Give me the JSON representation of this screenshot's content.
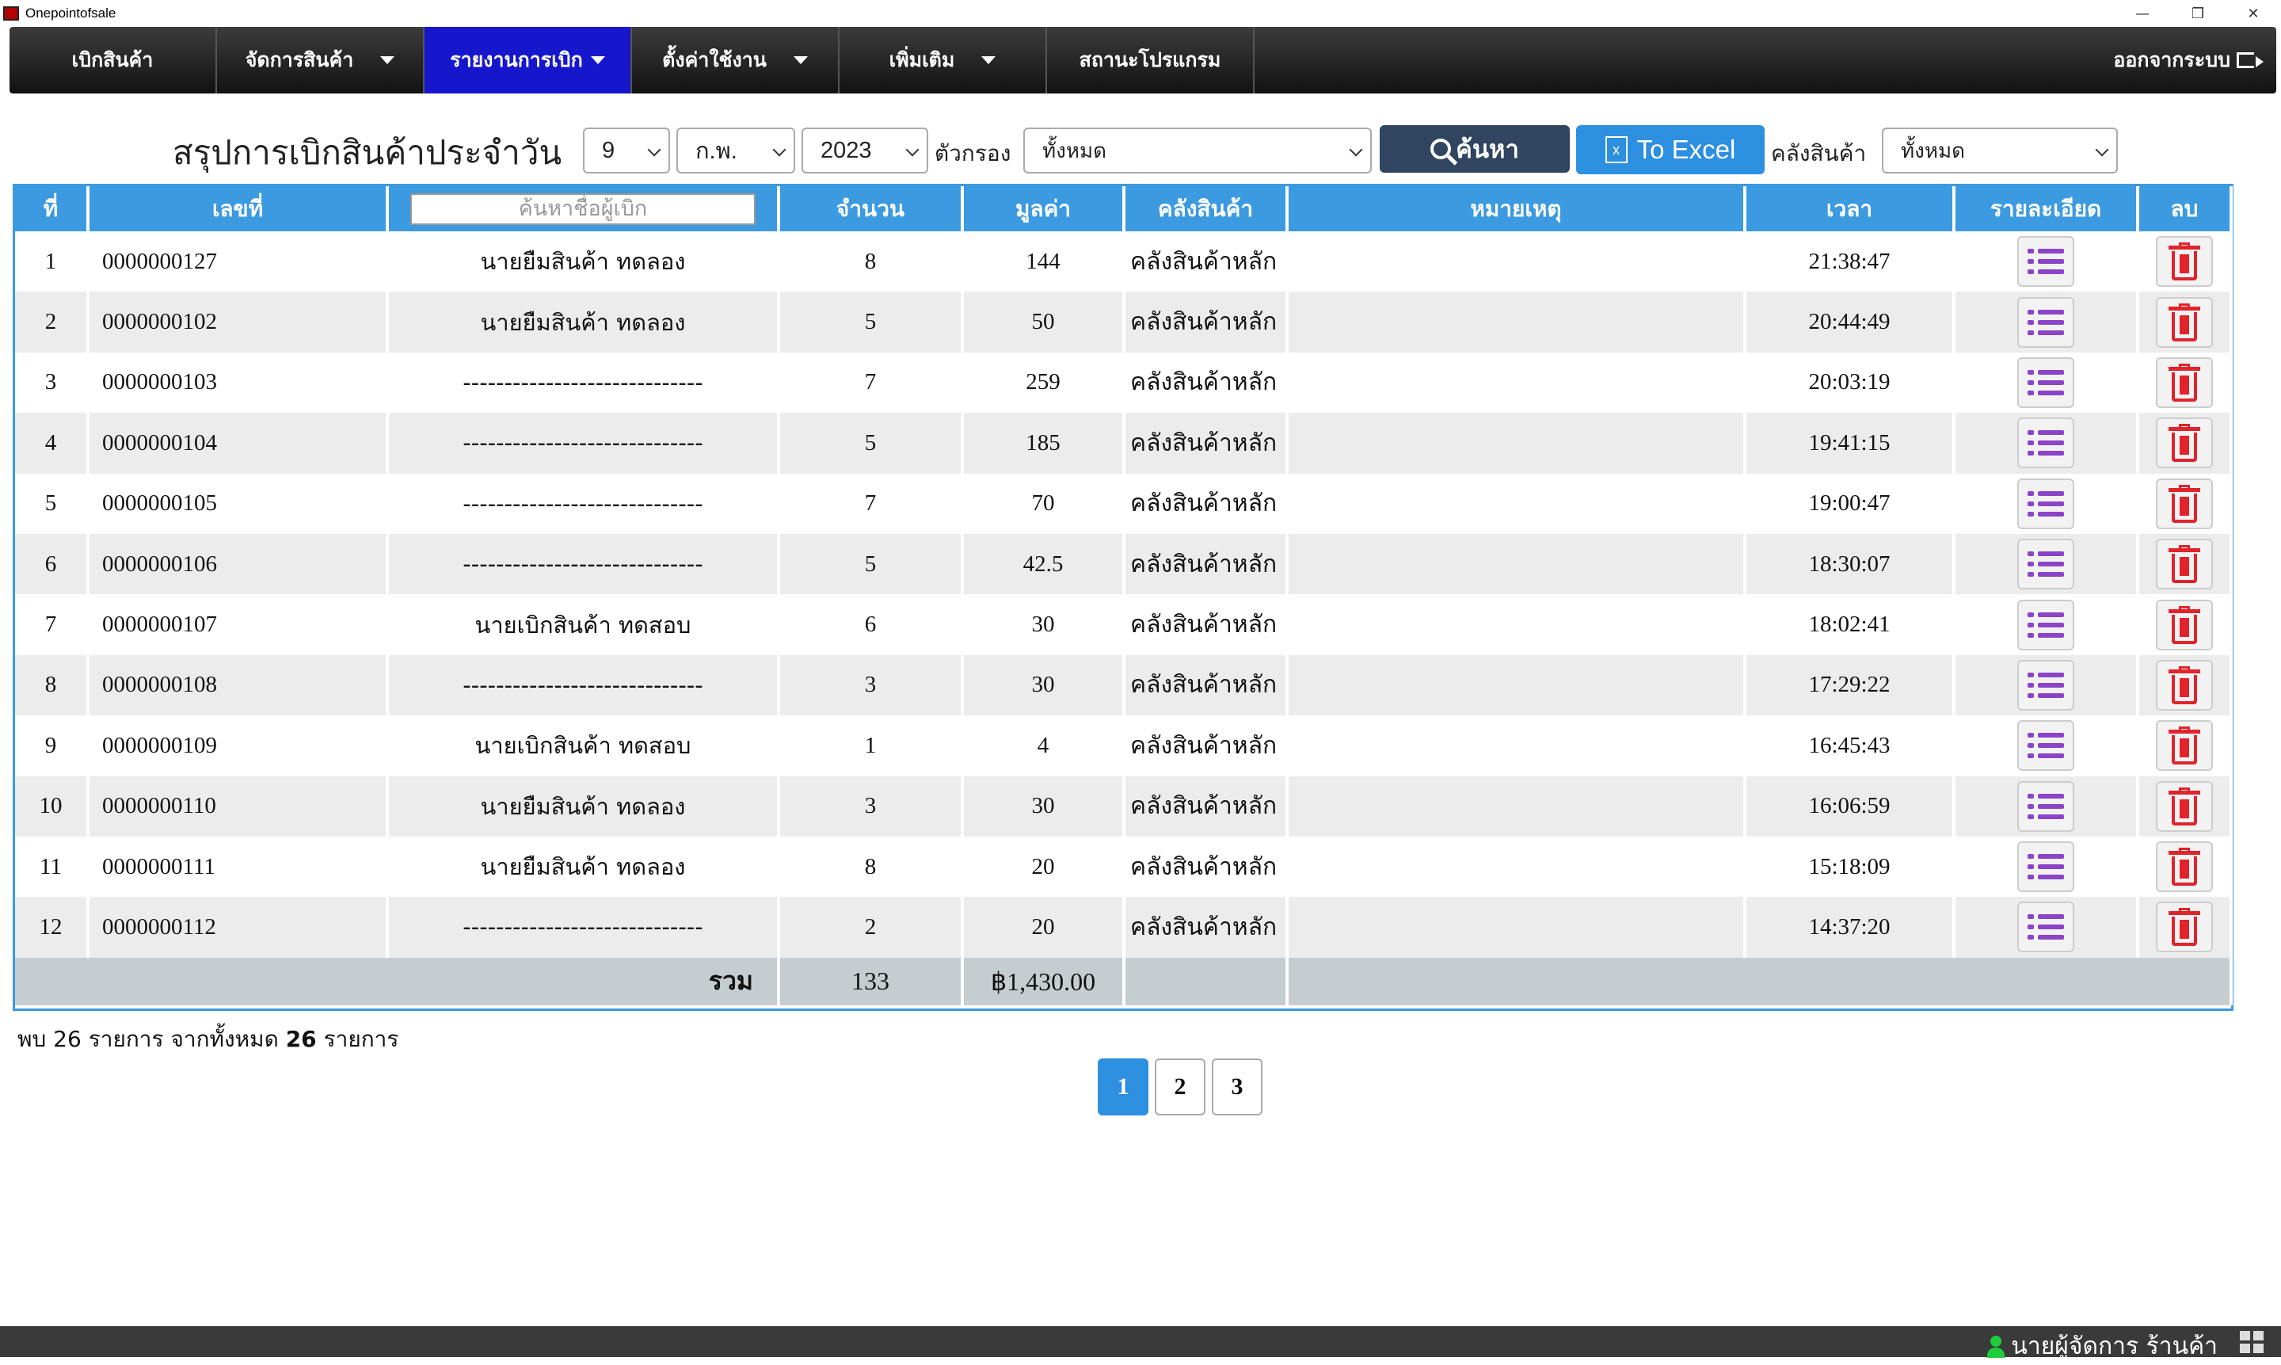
{
  "window": {
    "title": "Onepointofsale",
    "minimize": "—",
    "restore": "❐",
    "close": "✕"
  },
  "menu": {
    "items": [
      {
        "label": "เบิกสินค้า"
      },
      {
        "label": "จัดการสินค้า"
      },
      {
        "label": "รายงานการเบิก"
      },
      {
        "label": "ตั้งค่าใช้งาน"
      },
      {
        "label": "เพิ่มเติม"
      },
      {
        "label": "สถานะโปรแกรม"
      }
    ],
    "logout": "ออกจากระบบ"
  },
  "toolbar": {
    "title": "สรุปการเบิกสินค้าประจำวัน",
    "day": "9",
    "month": "ก.พ.",
    "year": "2023",
    "filter_label": "ตัวกรอง",
    "filter_value": "ทั้งหมด",
    "search_button": "ค้นหา",
    "excel_button": "To Excel",
    "warehouse_label": "คลังสินค้า",
    "warehouse_value": "ทั้งหมด"
  },
  "table": {
    "headers": {
      "no": "ที่",
      "doc": "เลขที่",
      "search_placeholder": "ค้นหาชื่อผู้เบิก",
      "qty": "จำนวน",
      "value": "มูลค่า",
      "warehouse": "คลังสินค้า",
      "note": "หมายเหตุ",
      "time": "เวลา",
      "detail": "รายละเอียด",
      "delete": "ลบ"
    },
    "rows": [
      {
        "no": "1",
        "doc": "0000000127",
        "requester": "นายยืมสินค้า ทดลอง",
        "qty": "8",
        "value": "144",
        "warehouse": "คลังสินค้าหลัก",
        "note": "",
        "time": "21:38:47"
      },
      {
        "no": "2",
        "doc": "0000000102",
        "requester": "นายยืมสินค้า ทดลอง",
        "qty": "5",
        "value": "50",
        "warehouse": "คลังสินค้าหลัก",
        "note": "",
        "time": "20:44:49"
      },
      {
        "no": "3",
        "doc": "0000000103",
        "requester": "-----------------------------",
        "qty": "7",
        "value": "259",
        "warehouse": "คลังสินค้าหลัก",
        "note": "",
        "time": "20:03:19"
      },
      {
        "no": "4",
        "doc": "0000000104",
        "requester": "-----------------------------",
        "qty": "5",
        "value": "185",
        "warehouse": "คลังสินค้าหลัก",
        "note": "",
        "time": "19:41:15"
      },
      {
        "no": "5",
        "doc": "0000000105",
        "requester": "-----------------------------",
        "qty": "7",
        "value": "70",
        "warehouse": "คลังสินค้าหลัก",
        "note": "",
        "time": "19:00:47"
      },
      {
        "no": "6",
        "doc": "0000000106",
        "requester": "-----------------------------",
        "qty": "5",
        "value": "42.5",
        "warehouse": "คลังสินค้าหลัก",
        "note": "",
        "time": "18:30:07"
      },
      {
        "no": "7",
        "doc": "0000000107",
        "requester": "นายเบิกสินค้า ทดสอบ",
        "qty": "6",
        "value": "30",
        "warehouse": "คลังสินค้าหลัก",
        "note": "",
        "time": "18:02:41"
      },
      {
        "no": "8",
        "doc": "0000000108",
        "requester": "-----------------------------",
        "qty": "3",
        "value": "30",
        "warehouse": "คลังสินค้าหลัก",
        "note": "",
        "time": "17:29:22"
      },
      {
        "no": "9",
        "doc": "0000000109",
        "requester": "นายเบิกสินค้า ทดสอบ",
        "qty": "1",
        "value": "4",
        "warehouse": "คลังสินค้าหลัก",
        "note": "",
        "time": "16:45:43"
      },
      {
        "no": "10",
        "doc": "0000000110",
        "requester": "นายยืมสินค้า ทดลอง",
        "qty": "3",
        "value": "30",
        "warehouse": "คลังสินค้าหลัก",
        "note": "",
        "time": "16:06:59"
      },
      {
        "no": "11",
        "doc": "0000000111",
        "requester": "นายยืมสินค้า ทดลอง",
        "qty": "8",
        "value": "20",
        "warehouse": "คลังสินค้าหลัก",
        "note": "",
        "time": "15:18:09"
      },
      {
        "no": "12",
        "doc": "0000000112",
        "requester": "-----------------------------",
        "qty": "2",
        "value": "20",
        "warehouse": "คลังสินค้าหลัก",
        "note": "",
        "time": "14:37:20"
      }
    ],
    "total": {
      "label": "รวม",
      "qty": "133",
      "value": "฿1,430.00"
    }
  },
  "summary": {
    "prefix": "พบ",
    "found": "26",
    "middle": "รายการ จากทั้งหมด",
    "total": "26",
    "suffix": "รายการ"
  },
  "pagination": {
    "pages": [
      "1",
      "2",
      "3"
    ],
    "current": "1"
  },
  "status": {
    "user": "นายผู้จัดการ ร้านค้า"
  },
  "colors": {
    "accent": "#3b9ae0",
    "active_menu": "#1616cc",
    "search_btn": "#2f4560",
    "excel_btn": "#2d8fe0",
    "detail_icon": "#8b44c7",
    "delete_icon": "#e0242c"
  },
  "icons": {
    "detail": "list-icon",
    "delete": "trash-icon",
    "search": "search-icon",
    "excel": "excel-icon",
    "logout": "logout-icon",
    "user": "user-icon"
  }
}
